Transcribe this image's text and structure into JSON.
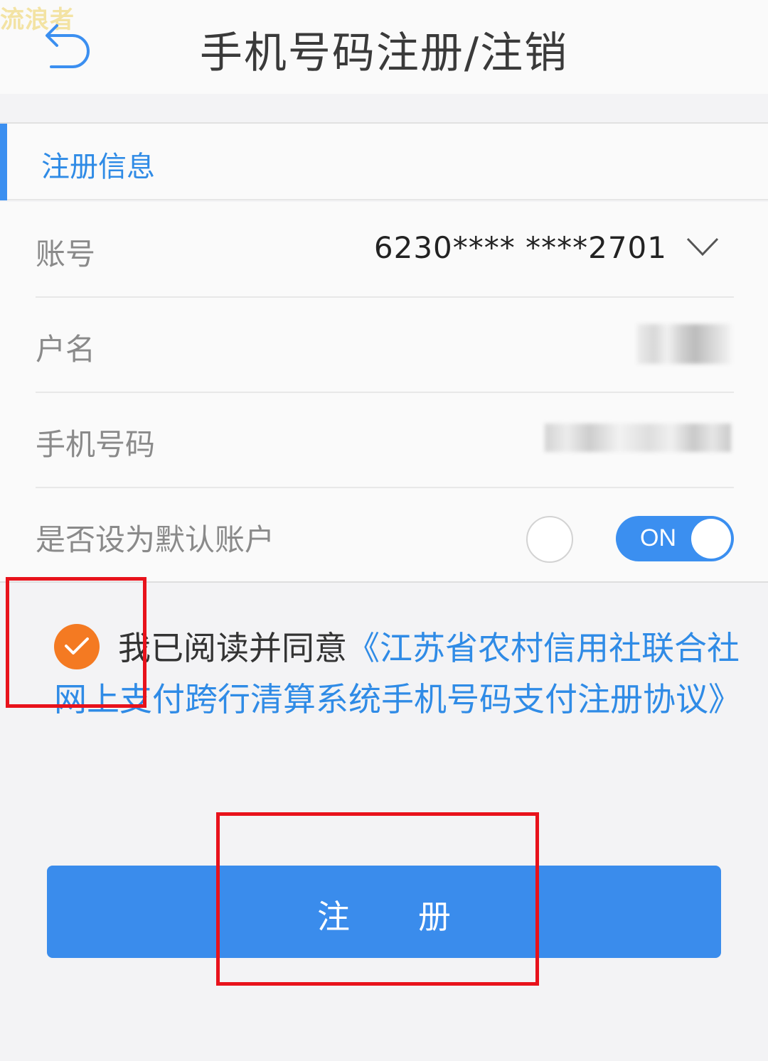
{
  "watermark": "流浪者",
  "header": {
    "title": "手机号码注册/注销"
  },
  "section": {
    "title": "注册信息"
  },
  "form": {
    "account": {
      "label": "账号",
      "value": "6230**** ****2701"
    },
    "name": {
      "label": "户名"
    },
    "phone": {
      "label": "手机号码"
    },
    "default_account": {
      "label": "是否设为默认账户",
      "toggle_text": "ON",
      "toggle_on": true
    }
  },
  "agreement": {
    "checked": true,
    "text": "我已阅读并同意",
    "link": "《江苏省农村信用社联合社网上支付跨行清算系统手机号码支付注册协议》"
  },
  "register_button": {
    "label": "注册"
  },
  "colors": {
    "accent": "#3a8cec",
    "check": "#f47a22",
    "annotation": "#e8121b"
  }
}
